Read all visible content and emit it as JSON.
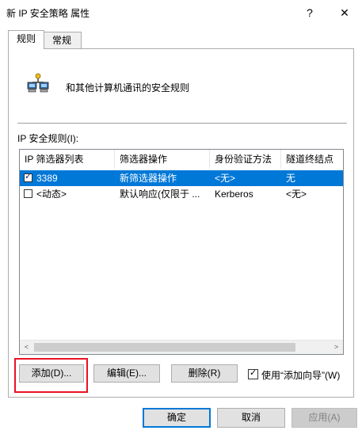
{
  "window": {
    "title": "新 IP 安全策略 属性",
    "help_label": "?",
    "close_label": "✕"
  },
  "tabs": [
    {
      "label": "规则",
      "active": true
    },
    {
      "label": "常规",
      "active": false
    }
  ],
  "description": "和其他计算机通讯的安全规则",
  "list_label": "IP 安全规则(I):",
  "columns": [
    "IP 筛选器列表",
    "筛选器操作",
    "身份验证方法",
    "隧道终结点"
  ],
  "rows": [
    {
      "checked": true,
      "selected": true,
      "cells": [
        "3389",
        "新筛选器操作",
        "<无>",
        "无"
      ]
    },
    {
      "checked": false,
      "selected": false,
      "cells": [
        "<动态>",
        "默认响应(仅限于 ...",
        "Kerberos",
        "<无>"
      ]
    }
  ],
  "scrollbar": {
    "left_arrow": "<",
    "right_arrow": ">"
  },
  "buttons": {
    "add": "添加(D)...",
    "edit": "编辑(E)...",
    "remove": "删除(R)",
    "use_wizard": "使用“添加向导”(W)",
    "use_wizard_checked": true
  },
  "footer": {
    "ok": "确定",
    "cancel": "取消",
    "apply": "应用(A)"
  },
  "colors": {
    "selection": "#0078d7",
    "highlight_box": "#e81123"
  }
}
